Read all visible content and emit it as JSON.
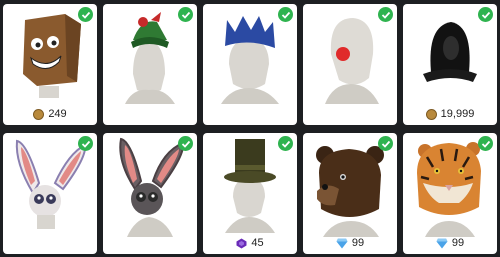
{
  "items": [
    {
      "name": "box-head",
      "owned": true,
      "price": "249",
      "currency": "coin"
    },
    {
      "name": "elf-hat",
      "owned": true,
      "price": "",
      "currency": ""
    },
    {
      "name": "paper-crown",
      "owned": true,
      "price": "",
      "currency": ""
    },
    {
      "name": "clown-nose",
      "owned": true,
      "price": "",
      "currency": ""
    },
    {
      "name": "black-hood",
      "owned": true,
      "price": "19,999",
      "currency": "coin"
    },
    {
      "name": "bunny-mask-white",
      "owned": true,
      "price": "",
      "currency": ""
    },
    {
      "name": "bunny-mask-gray",
      "owned": true,
      "price": "",
      "currency": ""
    },
    {
      "name": "green-top-hat",
      "owned": true,
      "price": "45",
      "currency": "purple-gem"
    },
    {
      "name": "bear-head",
      "owned": true,
      "price": "99",
      "currency": "diamond"
    },
    {
      "name": "tiger-head",
      "owned": true,
      "price": "99",
      "currency": "diamond"
    }
  ],
  "colors": {
    "check": "#2fb34f",
    "coin": "#b8893c",
    "purple_gem": "#6a2bb8",
    "diamond": "#4aa3e8"
  }
}
